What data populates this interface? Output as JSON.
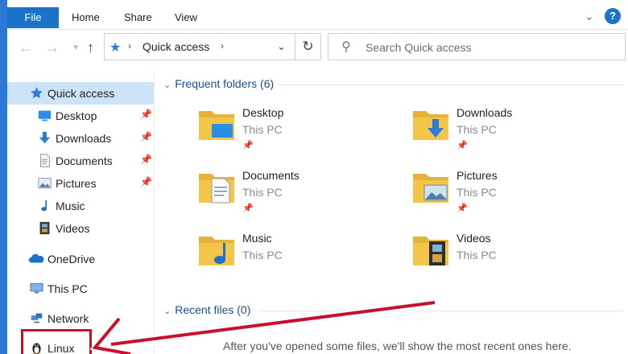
{
  "ribbon": {
    "tabs": [
      "File",
      "Home",
      "Share",
      "View"
    ],
    "help_label": "?"
  },
  "address": {
    "crumb": "Quick access",
    "search_placeholder": "Search Quick access"
  },
  "sidebar": {
    "items": [
      {
        "label": "Quick access",
        "icon": "star-icon"
      },
      {
        "label": "Desktop",
        "icon": "desktop-icon",
        "pinned": true
      },
      {
        "label": "Downloads",
        "icon": "download-arrow-icon",
        "pinned": true
      },
      {
        "label": "Documents",
        "icon": "document-icon",
        "pinned": true
      },
      {
        "label": "Pictures",
        "icon": "picture-icon",
        "pinned": true
      },
      {
        "label": "Music",
        "icon": "music-note-icon"
      },
      {
        "label": "Videos",
        "icon": "film-icon"
      },
      {
        "label": "OneDrive",
        "icon": "cloud-icon"
      },
      {
        "label": "This PC",
        "icon": "computer-icon"
      },
      {
        "label": "Network",
        "icon": "network-icon"
      },
      {
        "label": "Linux",
        "icon": "penguin-icon"
      }
    ]
  },
  "content": {
    "frequent_header": "Frequent folders (6)",
    "recent_header": "Recent files (0)",
    "empty_message": "After you've opened some files, we'll show the most recent ones here.",
    "folders": [
      {
        "name": "Desktop",
        "location": "This PC"
      },
      {
        "name": "Downloads",
        "location": "This PC"
      },
      {
        "name": "Documents",
        "location": "This PC"
      },
      {
        "name": "Pictures",
        "location": "This PC"
      },
      {
        "name": "Music",
        "location": "This PC"
      },
      {
        "name": "Videos",
        "location": "This PC"
      }
    ]
  },
  "colors": {
    "accent": "#1a73c8",
    "selection": "#cde3f8",
    "highlight": "#c8102e",
    "folder": "#f3c64a"
  }
}
